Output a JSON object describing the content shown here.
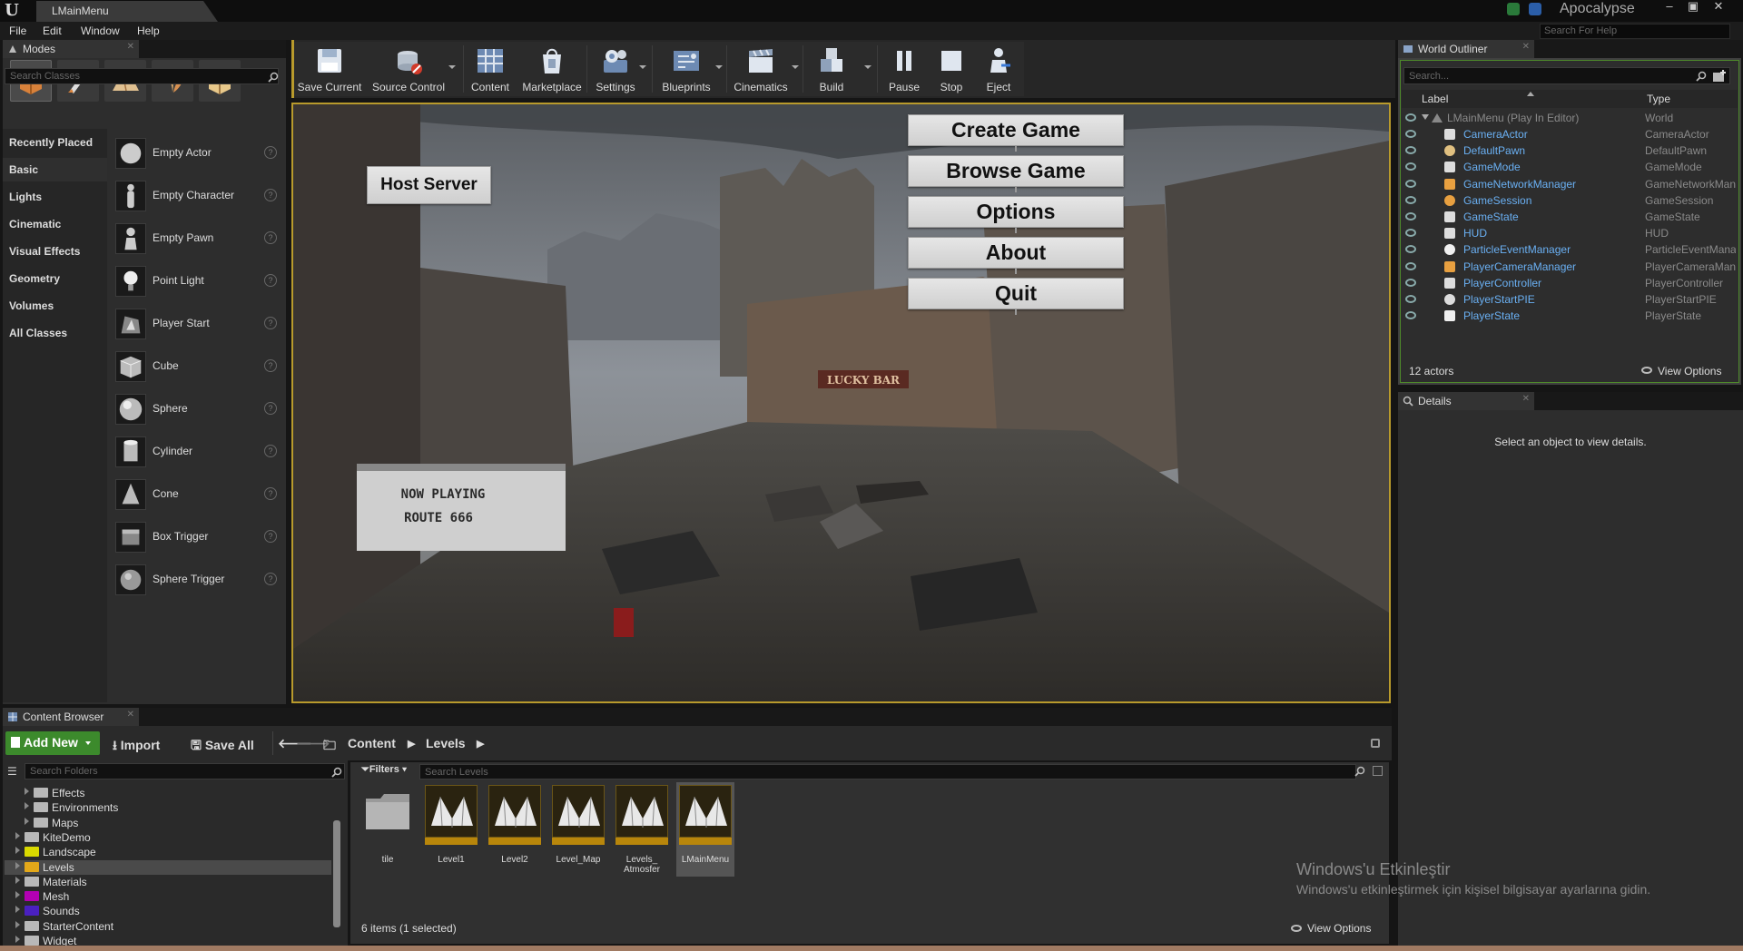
{
  "title_bar": {
    "tab": "LMainMenu",
    "project": "Apocalypse",
    "window_buttons": [
      "–",
      "▣",
      "✕"
    ]
  },
  "menu": [
    "File",
    "Edit",
    "Window",
    "Help"
  ],
  "help_search_placeholder": "Search For Help",
  "modes": {
    "tab": "Modes",
    "search_placeholder": "Search Classes",
    "categories": [
      "Recently Placed",
      "Basic",
      "Lights",
      "Cinematic",
      "Visual Effects",
      "Geometry",
      "Volumes",
      "All Classes"
    ],
    "selected_category": "Basic",
    "items": [
      "Empty Actor",
      "Empty Character",
      "Empty Pawn",
      "Point Light",
      "Player Start",
      "Cube",
      "Sphere",
      "Cylinder",
      "Cone",
      "Box Trigger",
      "Sphere Trigger"
    ]
  },
  "toolbar": {
    "buttons": [
      "Save Current",
      "Source Control",
      "Content",
      "Marketplace",
      "Settings",
      "Blueprints",
      "Cinematics",
      "Build",
      "Pause",
      "Stop",
      "Eject"
    ]
  },
  "viewport": {
    "menu_buttons": [
      "Create Game",
      "Browse Game",
      "Options",
      "About",
      "Quit"
    ],
    "host_button": "Host Server",
    "sign_line1": "NOW PLAYING",
    "sign_line2": "ROUTE 666",
    "shop_sign": "LUCKY BAR"
  },
  "outliner": {
    "tab": "World Outliner",
    "search_placeholder": "Search...",
    "col_label": "Label",
    "col_type": "Type",
    "root": {
      "name": "LMainMenu (Play In Editor)",
      "type": "World"
    },
    "rows": [
      {
        "name": "CameraActor",
        "type": "CameraActor"
      },
      {
        "name": "DefaultPawn",
        "type": "DefaultPawn"
      },
      {
        "name": "GameMode",
        "type": "GameMode"
      },
      {
        "name": "GameNetworkManager",
        "type": "GameNetworkMan"
      },
      {
        "name": "GameSession",
        "type": "GameSession"
      },
      {
        "name": "GameState",
        "type": "GameState"
      },
      {
        "name": "HUD",
        "type": "HUD"
      },
      {
        "name": "ParticleEventManager",
        "type": "ParticleEventMana"
      },
      {
        "name": "PlayerCameraManager",
        "type": "PlayerCameraMan"
      },
      {
        "name": "PlayerController",
        "type": "PlayerController"
      },
      {
        "name": "PlayerStartPIE",
        "type": "PlayerStartPIE"
      },
      {
        "name": "PlayerState",
        "type": "PlayerState"
      }
    ],
    "count": "12 actors",
    "view_options": "View Options"
  },
  "details": {
    "tab": "Details",
    "empty": "Select an object to view details."
  },
  "content_browser": {
    "tab": "Content Browser",
    "add_new": "Add New",
    "import": "Import",
    "save_all": "Save All",
    "path": [
      "Content",
      "Levels"
    ],
    "folders_search_placeholder": "Search Folders",
    "filters": "Filters",
    "levels_search_placeholder": "Search Levels",
    "tree": [
      {
        "label": "Effects",
        "indent": 2,
        "color": "#b8b8b8"
      },
      {
        "label": "Environments",
        "indent": 2,
        "color": "#b8b8b8"
      },
      {
        "label": "Maps",
        "indent": 2,
        "color": "#b8b8b8"
      },
      {
        "label": "KiteDemo",
        "indent": 1,
        "color": "#b8b8b8"
      },
      {
        "label": "Landscape",
        "indent": 1,
        "color": "#d9d900"
      },
      {
        "label": "Levels",
        "indent": 1,
        "color": "#e3a81a"
      },
      {
        "label": "Materials",
        "indent": 1,
        "color": "#b8b8b8"
      },
      {
        "label": "Mesh",
        "indent": 1,
        "color": "#b300b3"
      },
      {
        "label": "Sounds",
        "indent": 1,
        "color": "#4a20c0"
      },
      {
        "label": "StarterContent",
        "indent": 1,
        "color": "#b8b8b8"
      },
      {
        "label": "Widget",
        "indent": 1,
        "color": "#b8b8b8"
      }
    ],
    "selected_folder": "Levels",
    "assets": [
      {
        "label": "tile",
        "kind": "folder"
      },
      {
        "label": "Level1",
        "kind": "level"
      },
      {
        "label": "Level2",
        "kind": "level"
      },
      {
        "label": "Level_Map",
        "kind": "level"
      },
      {
        "label": "Levels_ Atmosfer",
        "kind": "level"
      },
      {
        "label": "LMainMenu",
        "kind": "level"
      }
    ],
    "selected_asset": "LMainMenu",
    "status": "6 items (1 selected)",
    "view_options": "View Options"
  },
  "watermark": {
    "title": "Windows'u Etkinleştir",
    "body": "Windows'u etkinleştirmek için kişisel bilgisayar ayarlarına gidin."
  },
  "colors": {
    "accent_green": "#3c8a2c",
    "viewport_border": "#b89a2c",
    "actor_name": "#6ab0f3",
    "selection": "#4e8a2b"
  }
}
